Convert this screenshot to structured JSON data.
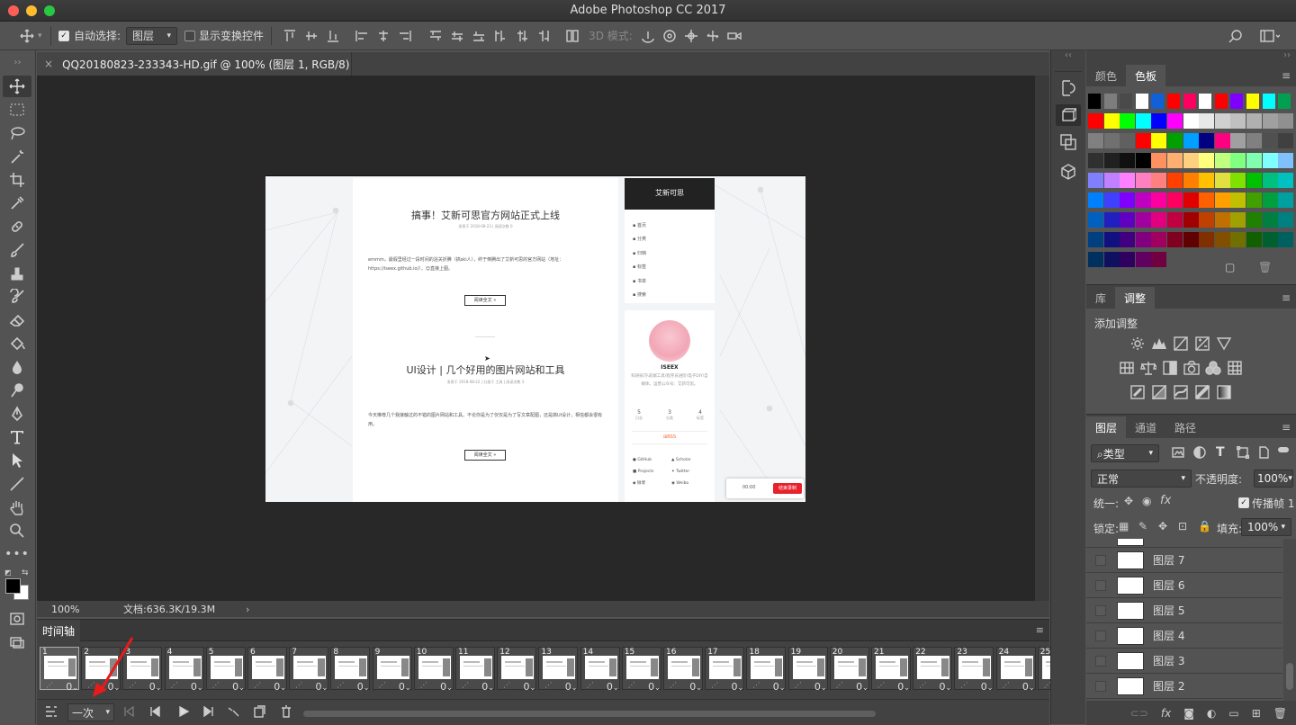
{
  "app": {
    "title": "Adobe Photoshop CC 2017"
  },
  "options": {
    "auto_select_label": "自动选择:",
    "layer_select": "图层",
    "show_transform_label": "显示变换控件",
    "mode_3d_label": "3D 模式:"
  },
  "document": {
    "tab_title": "QQ20180823-233343-HD.gif @ 100% (图层 1, RGB/8)",
    "zoom": "100%",
    "doc_size": "文档:636.3K/19.3M"
  },
  "webpage": {
    "post1_title": "搞事！艾新可思官方网站正式上线",
    "post1_meta": "发表于 2018-08-23  |  阅读次数 0",
    "post1_body": "emmm，最假里经过一段时间的浴关折腾（搞ski人），终于倒腾出了艾新可思的官方网站（地址：https://iseex.github.io/），😊直接上图。",
    "read_more": "阅读全文 »",
    "post2_title": "UI设计 | 几个好用的图片网站和工具",
    "post2_meta": "发表于 2018-08-22  |  分类于 工具  |  阅读次数 3",
    "post2_body": "今天推荐几个我接触过的不错的图片网站和工具。不论你是为了仅仅是为了写文章配图，还是搞UI设计，相信都会很有用。",
    "site_name": "艾新可思",
    "nav": [
      "首页",
      "分类",
      "归档",
      "标签",
      "书单",
      "搜索"
    ],
    "author": "ISEEX",
    "author_bio": "科研技巧\\前端工具\\程序员进阶\\电子DIY\\自媒体。运营公众号：艾新可思。",
    "stats": [
      {
        "n": "5",
        "l": "日志"
      },
      {
        "n": "3",
        "l": "分类"
      },
      {
        "n": "4",
        "l": "标签"
      }
    ],
    "rss": "RSS",
    "links": [
      "GitHub",
      "Scholar",
      "Projects",
      "Twitter",
      "微博",
      "Weibo"
    ],
    "rec_time": "00:00",
    "rec_btn": "结束录制"
  },
  "timeline": {
    "title": "时间轴",
    "frames": [
      "1",
      "2",
      "3",
      "4",
      "5",
      "6",
      "7",
      "8",
      "9",
      "10",
      "11",
      "12",
      "13",
      "14",
      "15",
      "16",
      "17",
      "18",
      "19",
      "20",
      "21",
      "22",
      "23",
      "24",
      "25"
    ],
    "delay": "0",
    "loop": "一次"
  },
  "panels": {
    "color_tab": "颜色",
    "swatches_tab": "色板",
    "library_tab": "库",
    "adjust_tab": "调整",
    "add_adjust": "添加调整",
    "layers_tab": "图层",
    "channels_tab": "通道",
    "paths_tab": "路径",
    "filter_kind": "类型",
    "blend_mode": "正常",
    "opacity_label": "不透明度:",
    "opacity": "100%",
    "unify_label": "统一:",
    "propagate_label": "传播帧 1",
    "lock_label": "锁定:",
    "fill_label": "填充:",
    "fill": "100%",
    "layers": [
      "图层 7",
      "图层 6",
      "图层 5",
      "图层 4",
      "图层 3",
      "图层 2"
    ]
  },
  "swatch_colors": [
    "#000000",
    "#7d7d7d",
    "#4a4a4a",
    "#ffffff",
    "#1060d8",
    "#ff0000",
    "#ff0060",
    "#ffffff",
    "#ff0000",
    "#8000ff",
    "#ffff00",
    "#00ffff",
    "#00a050",
    "#ff0000",
    "#ffff00",
    "#00ff00",
    "#00ffff",
    "#0000ff",
    "#ff00ff",
    "#ffffff",
    "#e8e8e8",
    "#d0d0d0",
    "#c0c0c0",
    "#b0b0b0",
    "#a0a0a0",
    "#909090",
    "#808080",
    "#707070",
    "#606060",
    "#ff0000",
    "#ffff00",
    "#00a000",
    "#00a0ff",
    "#000080",
    "#ff0080",
    "#a0a0a0",
    "#808080",
    "#505050",
    "#404040",
    "#303030",
    "#202020",
    "#101010",
    "#000000",
    "#ff9060",
    "#ffb070",
    "#ffd080",
    "#ffff80",
    "#c0ff80",
    "#80ff80",
    "#80ffb0",
    "#80ffff",
    "#80c0ff",
    "#8080ff",
    "#c080ff",
    "#ff80ff",
    "#ff80c0",
    "#ff8080",
    "#ff4000",
    "#ff8000",
    "#ffc000",
    "#e0e040",
    "#80e000",
    "#00c000",
    "#00c080",
    "#00c0c0",
    "#0080ff",
    "#4040ff",
    "#8000ff",
    "#c000c0",
    "#ff00a0",
    "#ff0060",
    "#e00000",
    "#ff6000",
    "#ffa000",
    "#c0c000",
    "#40a000",
    "#00a040",
    "#00a0a0",
    "#0060c0",
    "#2020c0",
    "#6000c0",
    "#a000a0",
    "#e00080",
    "#c00040",
    "#a00000",
    "#c04000",
    "#c07000",
    "#a0a000",
    "#208000",
    "#008040",
    "#008080",
    "#004080",
    "#101080",
    "#400080",
    "#800080",
    "#a00060",
    "#800020",
    "#600000",
    "#803000",
    "#805000",
    "#707000",
    "#106000",
    "#006030",
    "#006060",
    "#003060",
    "#101060",
    "#300060",
    "#600060",
    "#700040"
  ]
}
